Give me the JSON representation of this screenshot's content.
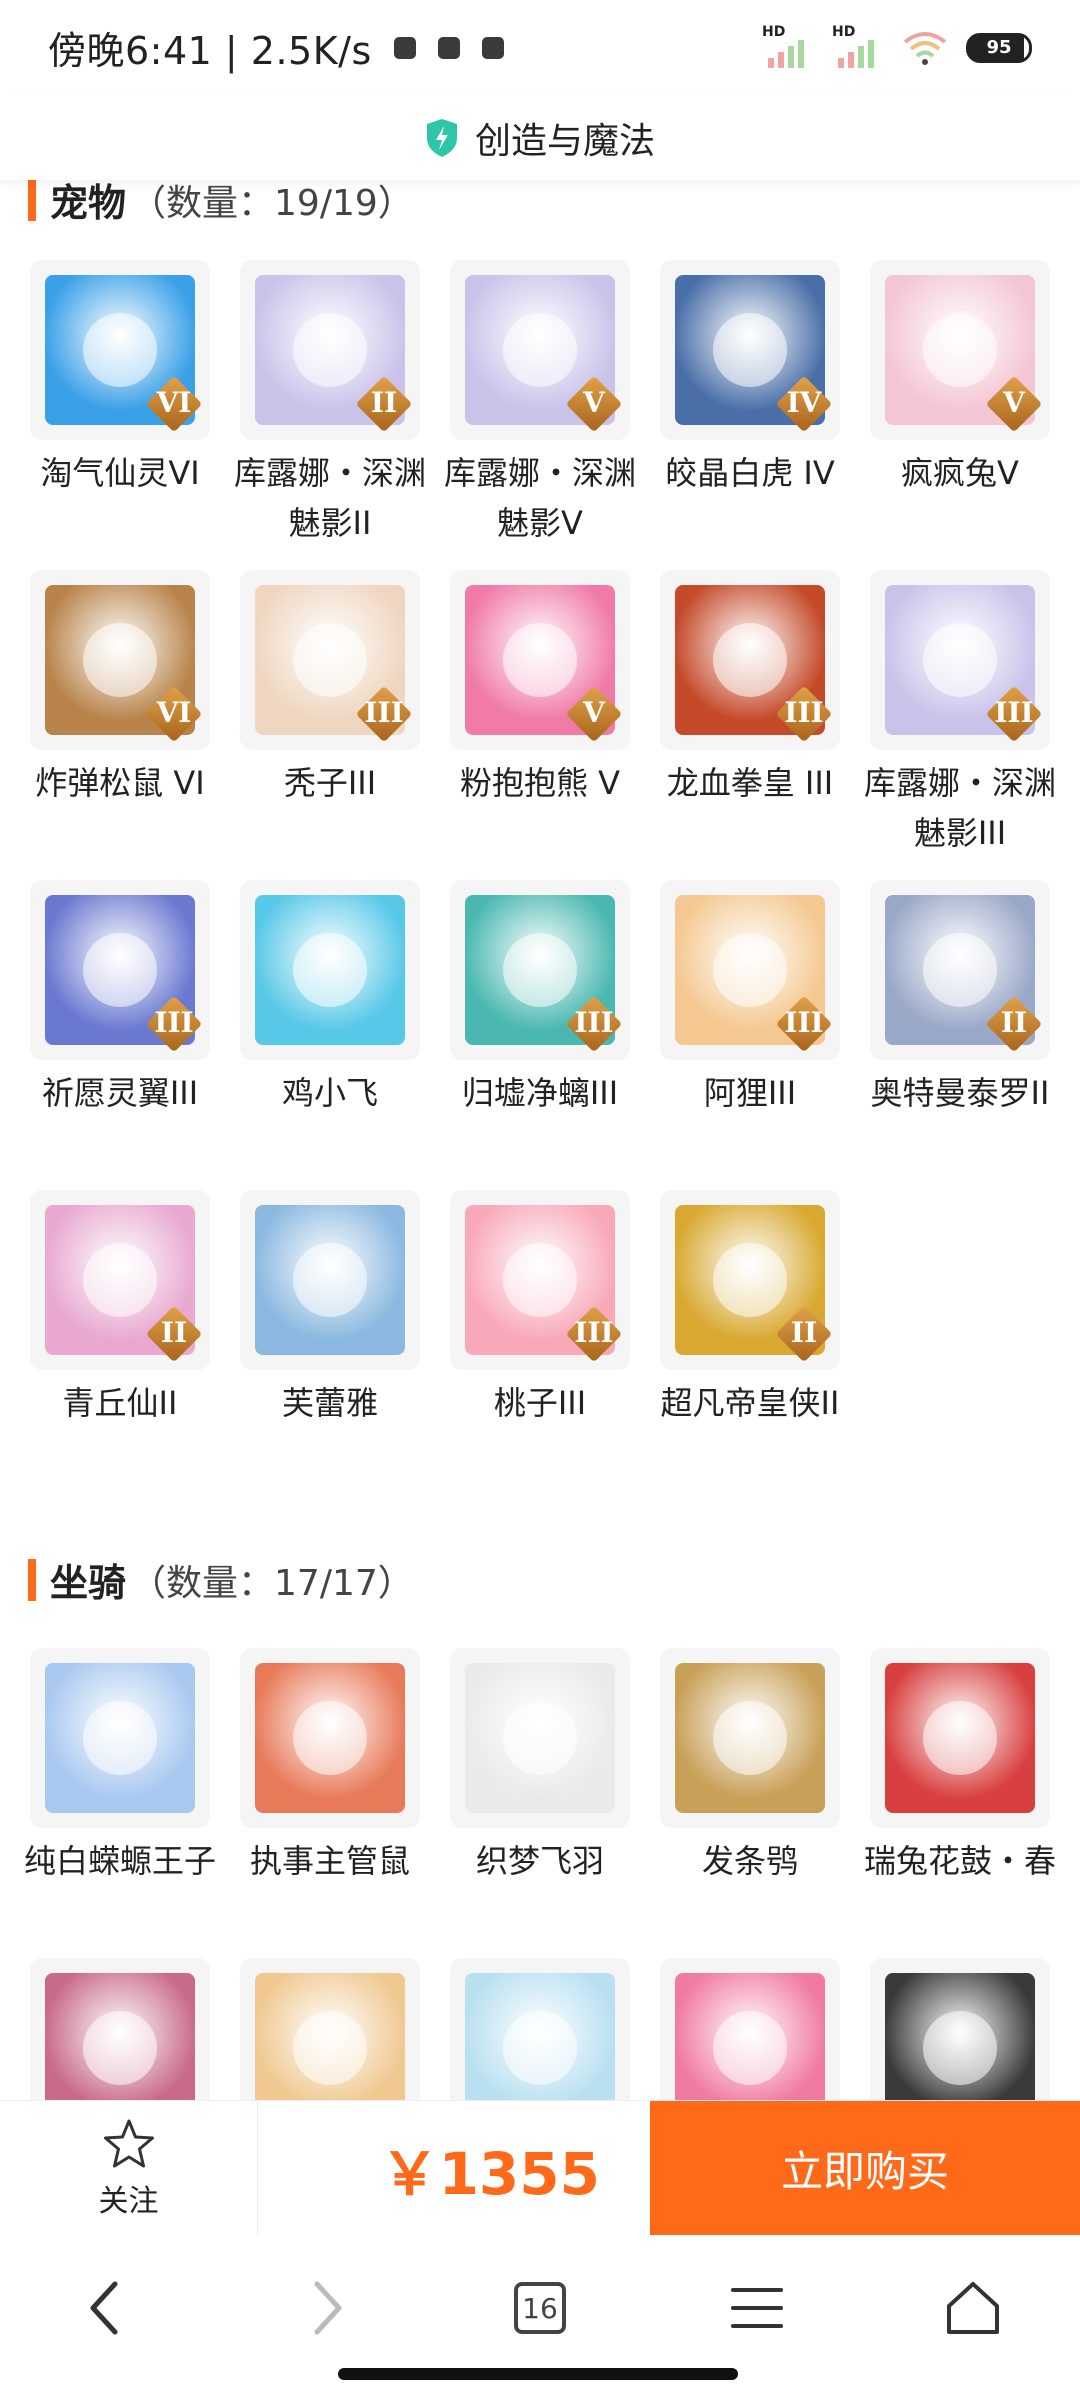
{
  "status": {
    "time": "傍晚6:41 | 2.5K/s",
    "hd1": "HD",
    "hd2": "HD",
    "battery": "95"
  },
  "header": {
    "title": "创造与魔法"
  },
  "pets": {
    "title": "宠物",
    "count": "（数量：19/19）",
    "items": [
      {
        "label": "淘气仙灵VI",
        "tier": "VI",
        "color": "#3aa0e8"
      },
      {
        "label": "库露娜・深渊魅影II",
        "tier": "II",
        "color": "#c9c3ea"
      },
      {
        "label": "库露娜・深渊魅影V",
        "tier": "V",
        "color": "#c9c3ea"
      },
      {
        "label": "皎晶白虎 IV",
        "tier": "IV",
        "color": "#4a6fa8"
      },
      {
        "label": "疯疯兔V",
        "tier": "V",
        "color": "#f4c6d4"
      },
      {
        "label": "炸弹松鼠 VI",
        "tier": "VI",
        "color": "#b8834a"
      },
      {
        "label": "秃子III",
        "tier": "III",
        "color": "#efd6c0"
      },
      {
        "label": "粉抱抱熊 V",
        "tier": "V",
        "color": "#f07aa8"
      },
      {
        "label": "龙血拳皇 III",
        "tier": "III",
        "color": "#c44a2a"
      },
      {
        "label": "库露娜・深渊魅影III",
        "tier": "III",
        "color": "#c9c3ea"
      },
      {
        "label": "祈愿灵翼III",
        "tier": "III",
        "color": "#6a78d0"
      },
      {
        "label": "鸡小飞",
        "tier": "",
        "color": "#58c8e8"
      },
      {
        "label": "归墟净螭III",
        "tier": "III",
        "color": "#4ab8b0"
      },
      {
        "label": "阿狸III",
        "tier": "III",
        "color": "#f4c890"
      },
      {
        "label": "奥特曼泰罗II",
        "tier": "II",
        "color": "#9aa8c8"
      },
      {
        "label": "青丘仙II",
        "tier": "II",
        "color": "#e8a8d0"
      },
      {
        "label": "芙蕾雅",
        "tier": "",
        "color": "#8ab8e0"
      },
      {
        "label": "桃子III",
        "tier": "III",
        "color": "#f8a8b8"
      },
      {
        "label": "超凡帝皇侠II",
        "tier": "II",
        "color": "#d8a830"
      }
    ]
  },
  "mounts": {
    "title": "坐骑",
    "count": "（数量：17/17）",
    "items": [
      {
        "label": "纯白蝾螈王子",
        "tier": "",
        "color": "#a8c8f0"
      },
      {
        "label": "执事主管鼠",
        "tier": "",
        "color": "#e87a5a"
      },
      {
        "label": "织梦飞羽",
        "tier": "",
        "color": "#eaeaea"
      },
      {
        "label": "发条鸮",
        "tier": "",
        "color": "#c8a058"
      },
      {
        "label": "瑞兔花鼓・春",
        "tier": "",
        "color": "#d84040"
      },
      {
        "label": "",
        "tier": "",
        "color": "#c86a8a"
      },
      {
        "label": "",
        "tier": "",
        "color": "#f0c890"
      },
      {
        "label": "",
        "tier": "",
        "color": "#b8e0f0"
      },
      {
        "label": "",
        "tier": "",
        "color": "#f07aa0"
      },
      {
        "label": "",
        "tier": "",
        "color": "#3a3a3a"
      }
    ]
  },
  "bottom": {
    "follow": "关注",
    "price": "￥1355",
    "buy": "立即购买"
  },
  "nav": {
    "tabs_count": "16"
  }
}
